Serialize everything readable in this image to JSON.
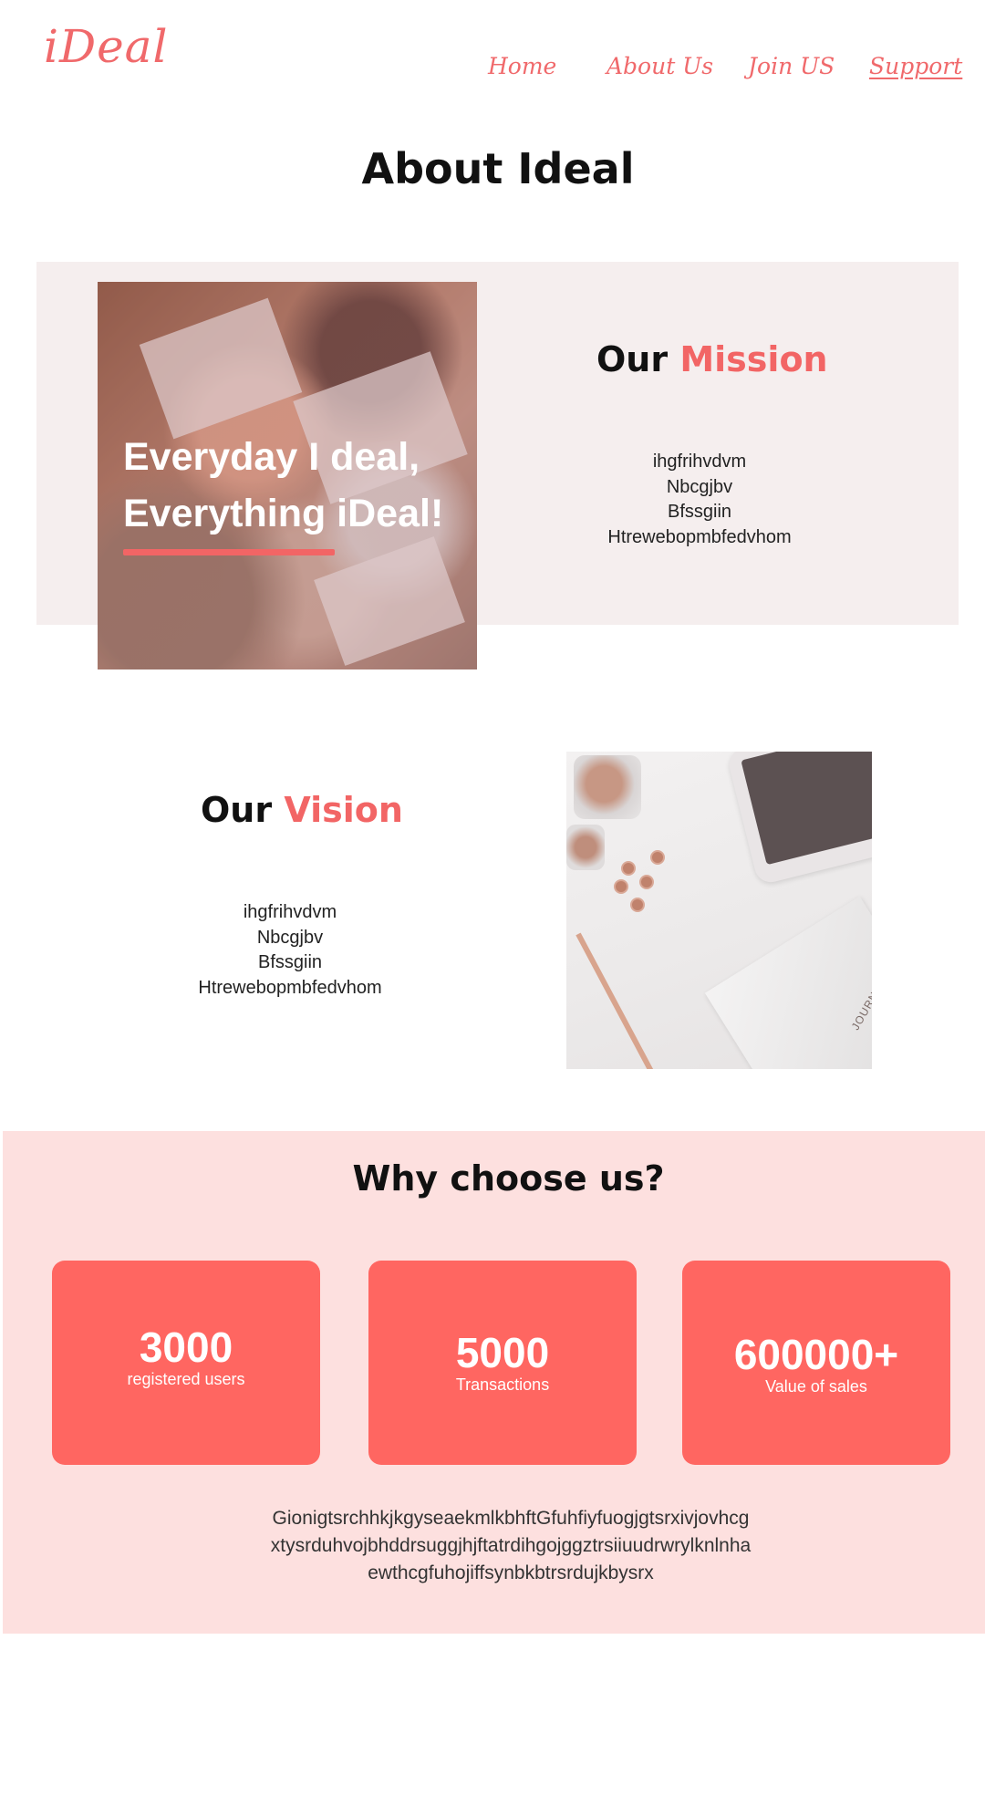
{
  "header": {
    "logo": "iDeal",
    "nav": {
      "home": "Home",
      "about": "About Us",
      "join": "Join US",
      "support": "Support"
    }
  },
  "page": {
    "title": "About Ideal"
  },
  "mission": {
    "slogan_line1": "Everyday I deal,",
    "slogan_line2": "Everything iDeal!",
    "heading_prefix": "Our",
    "heading_accent": "Mission",
    "lines": [
      "ihgfrihvdvm",
      "Nbcgjbv",
      "Bfssgiin",
      "Htrewebopmbfedvhom"
    ]
  },
  "vision": {
    "heading_prefix": "Our",
    "heading_accent": "Vision",
    "lines": [
      "ihgfrihvdvm",
      "Nbcgjbv",
      "Bfssgiin",
      "Htrewebopmbfedvhom"
    ],
    "journal_label": "JOURNAL"
  },
  "why": {
    "title": "Why choose us?",
    "stats": [
      {
        "value": "3000",
        "label": "registered users"
      },
      {
        "value": "5000",
        "label": "Transactions"
      },
      {
        "value": "600000+",
        "label": "Value of sales"
      }
    ],
    "text_lines": [
      "Gionigtsrchhkjkgyseaekmlkbhft­Gfuhfiyfuogjgtsrxivjovhcg",
      "xtysrduhvojbhddrsuggjhjftatrdihgojggztrsiiuudrwrylknlnha",
      "ewthcgfuhojiffsynbkbtrsrdujkbysrx"
    ]
  },
  "colors": {
    "accent": "#f26565",
    "logo": "#f0696b",
    "mission_band": "#f5eeee",
    "why_band": "#fde0df",
    "stat_card": "#ff6661"
  }
}
